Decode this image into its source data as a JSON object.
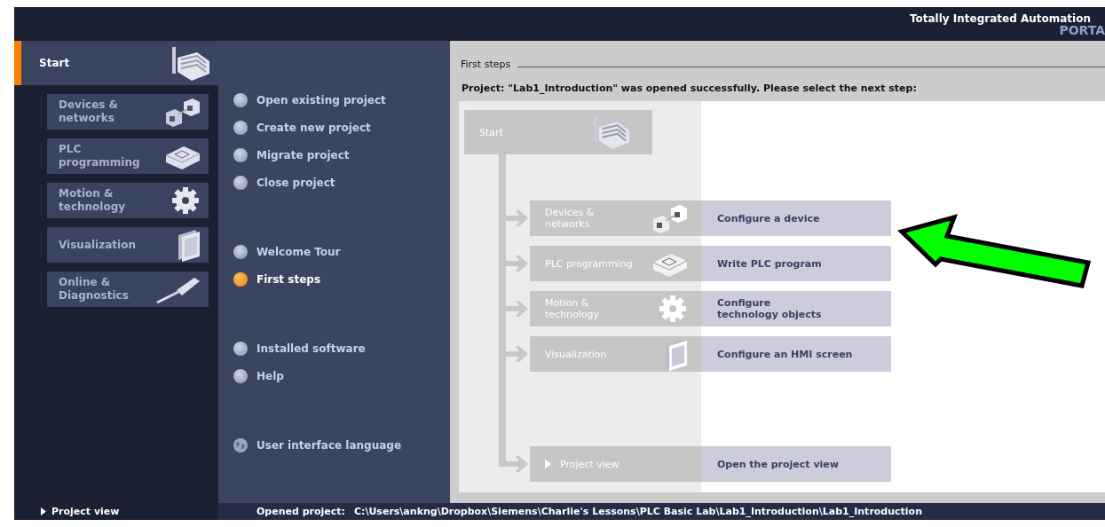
{
  "header": {
    "title": "Totally Integrated Automation",
    "subtitle": "PORTA"
  },
  "nav": {
    "start": {
      "label": "Start",
      "selected": true
    },
    "items": [
      {
        "label": "Devices &\nnetworks",
        "kind": "devices"
      },
      {
        "label": "PLC\nprogramming",
        "kind": "plc"
      },
      {
        "label": "Motion &\ntechnology",
        "kind": "motion"
      },
      {
        "label": "Visualization",
        "kind": "visualization"
      },
      {
        "label": "Online &\nDiagnostics",
        "kind": "online"
      }
    ],
    "project_view": "Project view"
  },
  "actions": [
    [
      {
        "label": "Open existing project",
        "selected": false,
        "kind": "bullet"
      },
      {
        "label": "Create new project",
        "selected": false,
        "kind": "bullet"
      },
      {
        "label": "Migrate project",
        "selected": false,
        "kind": "bullet"
      },
      {
        "label": "Close project",
        "selected": false,
        "kind": "bullet"
      }
    ],
    [
      {
        "label": "Welcome Tour",
        "selected": false,
        "kind": "bullet"
      },
      {
        "label": "First steps",
        "selected": true,
        "kind": "bullet"
      }
    ],
    [
      {
        "label": "Installed software",
        "selected": false,
        "kind": "bullet"
      },
      {
        "label": "Help",
        "selected": false,
        "kind": "bullet"
      }
    ],
    [
      {
        "label": "User interface language",
        "kind": "globe"
      }
    ]
  ],
  "content": {
    "title": "First steps",
    "message": "Project: \"Lab1_Introduction\" was opened successfully. Please select the next step:",
    "start": "Start",
    "steps": [
      {
        "label": "Devices &\nnetworks",
        "kind": "devices",
        "action": "Configure a device"
      },
      {
        "label": "PLC programming",
        "kind": "plc",
        "action": "Write PLC program"
      },
      {
        "label": "Motion &\ntechnology",
        "kind": "motion",
        "action": "Configure\ntechnology objects"
      },
      {
        "label": "Visualization",
        "kind": "visualization",
        "action": "Configure an HMI screen"
      },
      {
        "label": "Project view",
        "kind": "project_view",
        "action": "Open the project view"
      }
    ]
  },
  "status_bar": {
    "label": "Opened project:",
    "path": "C:\\Users\\ankng\\Dropbox\\Siemens\\Charlie's Lessons\\PLC Basic Lab\\Lab1_Introduction\\Lab1_Introduction"
  }
}
